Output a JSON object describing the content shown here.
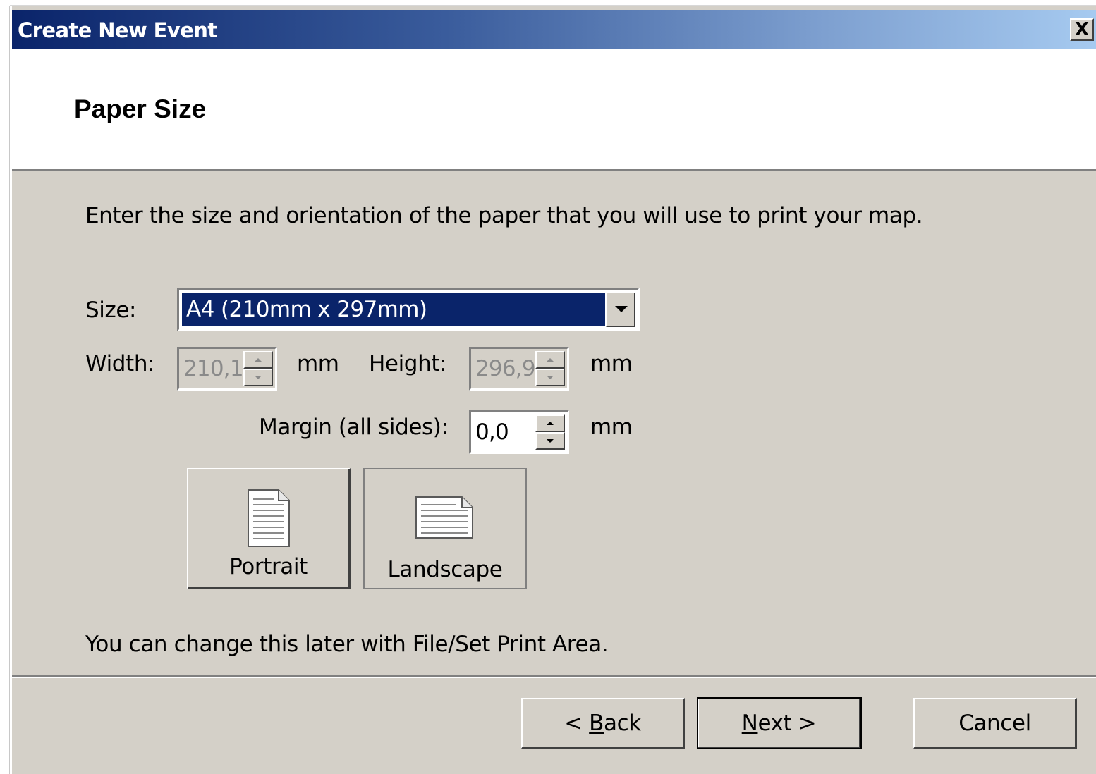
{
  "window": {
    "title": "Create New Event",
    "close_label": "X"
  },
  "header": {
    "heading": "Paper Size"
  },
  "instructions": "Enter the size and orientation of the paper that you will use to print your map.",
  "form": {
    "size_label": "Size:",
    "size_value": "A4 (210mm x 297mm)",
    "width_label": "Width:",
    "width_value": "210,1",
    "width_unit": "mm",
    "height_label": "Height:",
    "height_value": "296,9",
    "height_unit": "mm",
    "margin_label": "Margin (all sides):",
    "margin_value": "0,0",
    "margin_unit": "mm"
  },
  "orientation": {
    "portrait_label": "Portrait",
    "landscape_label": "Landscape",
    "selected": "Portrait"
  },
  "footnote": "You can change this later with File/Set Print Area.",
  "buttons": {
    "back": "< Back",
    "_back_prefix": "< ",
    "_back_mnemonic": "B",
    "_back_rest": "ack",
    "next": "Next >",
    "_next_mnemonic": "N",
    "_next_rest": "ext >",
    "cancel": "Cancel"
  },
  "colors": {
    "dialog_bg": "#d4d0c8",
    "title_start": "#0a246a",
    "title_end": "#a6caf0",
    "selection": "#0a246a"
  },
  "icons": {
    "portrait": "portrait-page-icon",
    "landscape": "landscape-page-icon",
    "close": "close-icon"
  }
}
